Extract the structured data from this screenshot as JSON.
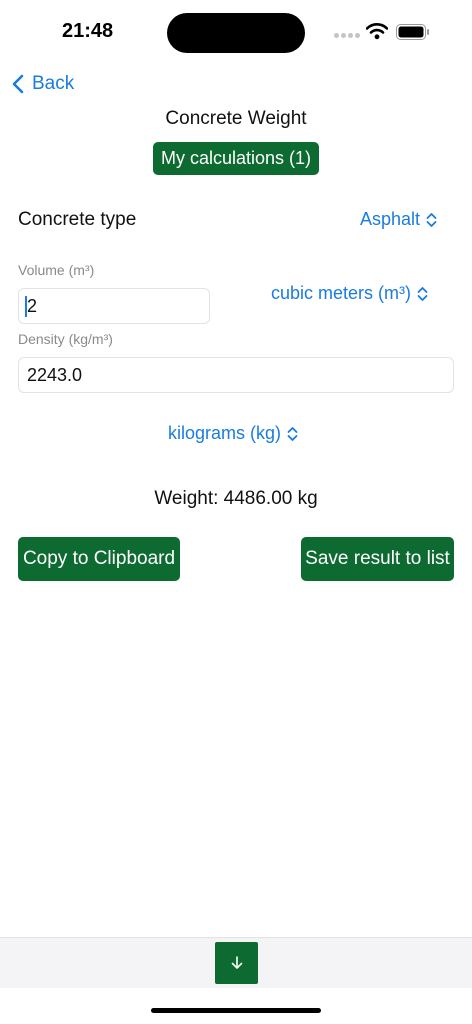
{
  "status_bar": {
    "time": "21:48",
    "icons": [
      "signal-dots-icon",
      "wifi-icon",
      "battery-icon"
    ]
  },
  "nav": {
    "back_label": "Back",
    "back_icon": "chevron-left-icon",
    "title": "Concrete Weight"
  },
  "my_calculations_label": "My calculations (1)",
  "concrete_type": {
    "label": "Concrete type",
    "value": "Asphalt",
    "icon": "chevron-up-down-icon"
  },
  "volume": {
    "label": "Volume (m³)",
    "value": "2",
    "unit": "cubic meters (m³)"
  },
  "density": {
    "label": "Density (kg/m³)",
    "value": "2243.0"
  },
  "weight_unit": "kilograms (kg)",
  "result": "Weight: 4486.00 kg",
  "actions": {
    "copy_label": "Copy to Clipboard",
    "save_label": "Save result to list"
  },
  "bottom_bar": {
    "icon": "arrow-down-icon"
  },
  "colors": {
    "accent_green": "#0d6a31",
    "link_blue": "#1a7ce0"
  }
}
